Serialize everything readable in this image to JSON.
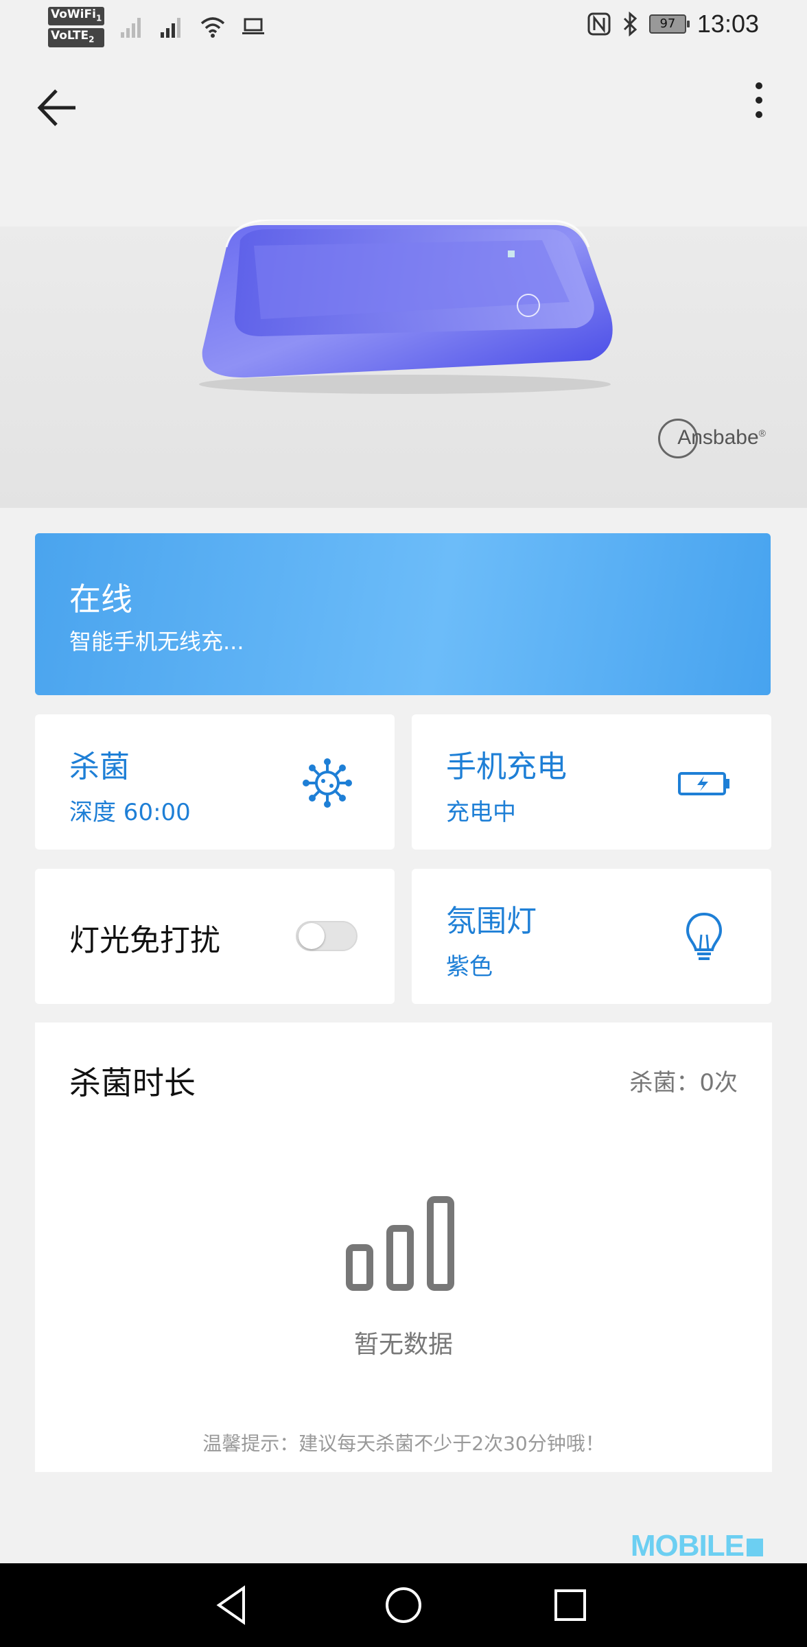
{
  "status_bar": {
    "net_badge_1": "VoWiFi",
    "net_badge_1_sub": "1",
    "net_badge_2": "VoLTE",
    "net_badge_2_sub": "2",
    "battery": "97",
    "time": "13:03"
  },
  "hero": {
    "brand": "Ansbabe"
  },
  "status_card": {
    "title": "在线",
    "subtitle": "智能手机无线充..."
  },
  "tiles": [
    {
      "title": "杀菌",
      "subtitle": "深度 60:00",
      "icon": "bacteria-icon"
    },
    {
      "title": "手机充电",
      "subtitle": "充电中",
      "icon": "battery-charging-icon"
    },
    {
      "title": "灯光免打扰",
      "toggle_on": false
    },
    {
      "title": "氛围灯",
      "subtitle": "紫色",
      "icon": "lightbulb-icon"
    }
  ],
  "stats": {
    "title": "杀菌时长",
    "count": "杀菌：0次",
    "empty_text": "暂无数据",
    "tip": "温馨提示：建议每天杀菌不少于2次30分钟哦！"
  },
  "watermark": "MOBILE",
  "colors": {
    "accent": "#1e7fd6",
    "card_gradient_start": "#4aa4ee",
    "card_gradient_end": "#47a3ef",
    "background": "#f1f1f1"
  }
}
